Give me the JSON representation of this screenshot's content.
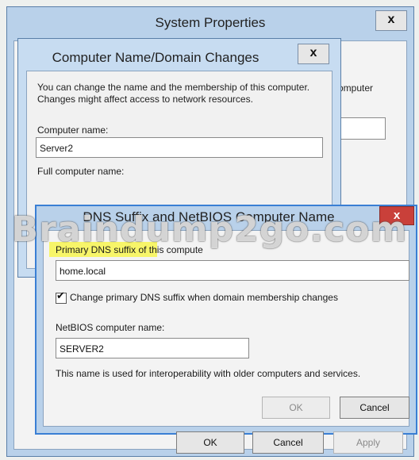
{
  "system_properties": {
    "title": "System Properties",
    "close_label": "x",
    "partial_text": "omputer",
    "buttons": {
      "ok": "OK",
      "cancel": "Cancel",
      "apply": "Apply"
    }
  },
  "computer_name_dialog": {
    "title": "Computer Name/Domain Changes",
    "close_label": "x",
    "description": "You can change the name and the membership of this computer. Changes might affect access to network resources.",
    "computer_name_label": "Computer name:",
    "computer_name_value": "Server2",
    "full_name_label": "Full computer name:"
  },
  "dns_dialog": {
    "title": "DNS Suffix and NetBIOS Computer Name",
    "close_label": "x",
    "primary_dns_label": "Primary DNS suffix of this compute",
    "primary_dns_value": "home.local",
    "checkbox_label": "Change primary DNS suffix when domain membership changes",
    "checkbox_checked": true,
    "netbios_label": "NetBIOS computer name:",
    "netbios_value": "SERVER2",
    "note": "This name is used for interoperability with older computers and services.",
    "buttons": {
      "ok": "OK",
      "cancel": "Cancel"
    }
  },
  "watermark": "Braindump2go.com",
  "colors": {
    "title_bar": "#b9d1ea",
    "active_border": "#3a7fd4",
    "close_red": "#c9403a",
    "highlight": "#f7f55a"
  }
}
